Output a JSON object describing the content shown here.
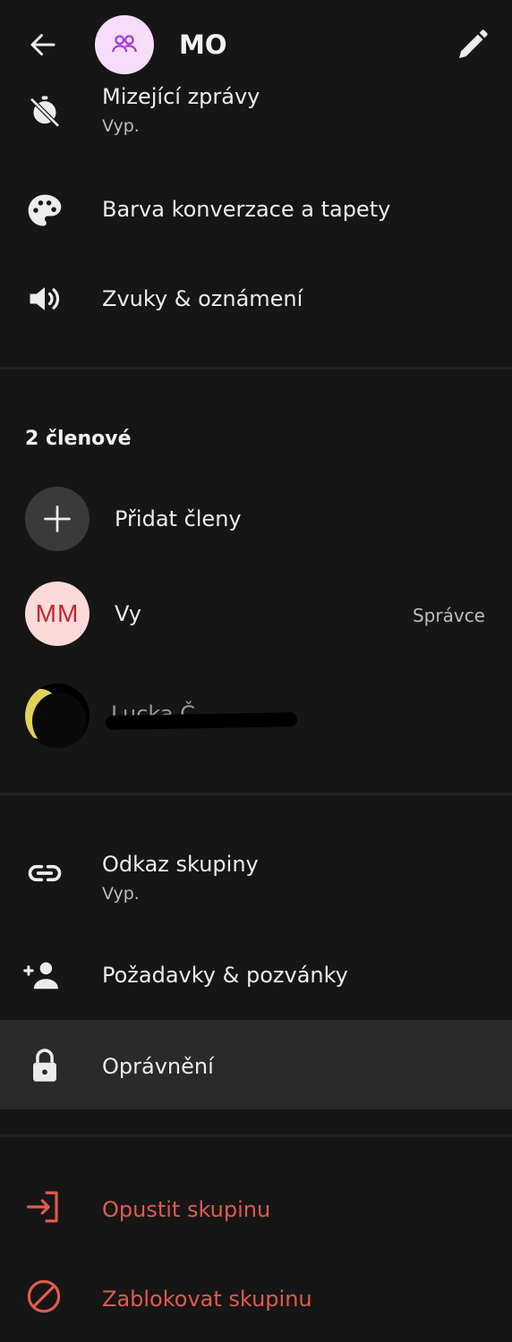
{
  "header": {
    "title": "MO",
    "back_icon": "back-arrow-icon",
    "edit_icon": "pencil-icon",
    "avatar_icon": "group-people-icon"
  },
  "settings": {
    "disappearing": {
      "label": "Mizející zprávy",
      "value": "Vyp."
    },
    "color": {
      "label": "Barva konverzace a tapety"
    },
    "sounds": {
      "label": "Zvuky & oznámení"
    }
  },
  "members": {
    "heading": "2 členové",
    "add_label": "Přidat členy",
    "me": {
      "initials": "MM",
      "name": "Vy",
      "role": "Správce"
    },
    "other": {
      "name": "Lucka Č…",
      "redacted": true
    }
  },
  "group": {
    "link": {
      "label": "Odkaz skupiny",
      "value": "Vyp."
    },
    "requests": {
      "label": "Požadavky & pozvánky"
    },
    "permissions": {
      "label": "Oprávnění"
    }
  },
  "danger": {
    "leave": {
      "label": "Opustit skupinu"
    },
    "block": {
      "label": "Zablokovat skupinu"
    }
  },
  "colors": {
    "background": "#161616",
    "highlight_row": "#2a2a2a",
    "danger": "#e05a4f",
    "avatar_group_bg": "#f7ddfb",
    "avatar_group_fg": "#a23bcf",
    "avatar_me_bg": "#fbdada",
    "avatar_me_fg": "#c0262b"
  }
}
